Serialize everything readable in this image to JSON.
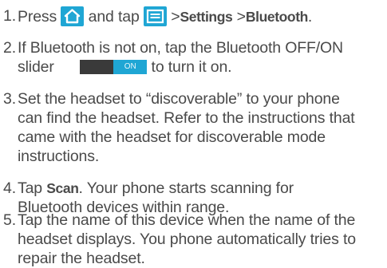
{
  "steps": [
    {
      "number": "1.",
      "press": "Press",
      "home_icon": "home-icon",
      "and_tap": "and tap",
      "menu_icon": "menu-icon",
      "sep1": ">",
      "settings": "Settings",
      "sep2": ">",
      "bluetooth": "Bluetooth",
      "period": "."
    },
    {
      "number": "2.",
      "line1": "If Bluetooth is not on, tap the Bluetooth OFF/ON",
      "line2_start": "slider",
      "slider_label": "ON",
      "line2_end": "to turn it on."
    },
    {
      "number": "3.",
      "lines": [
        "Set the headset to “discoverable” to your phone",
        "can find the headset. Refer to the instructions that",
        "came with the headset for discoverable mode",
        "instructions."
      ]
    },
    {
      "number": "4.",
      "tap": "Tap",
      "scan": "Scan",
      "line1_rest": ". Your phone starts scanning for",
      "line2": "Bluetooth devices within range."
    },
    {
      "number": "5.",
      "lines": [
        "Tap the name of this device when the name of the",
        "headset displays. You phone automatically tries to",
        "repair the headset."
      ]
    }
  ],
  "colors": {
    "text": "#4a4a4a",
    "accent": "#1fa6d4"
  }
}
